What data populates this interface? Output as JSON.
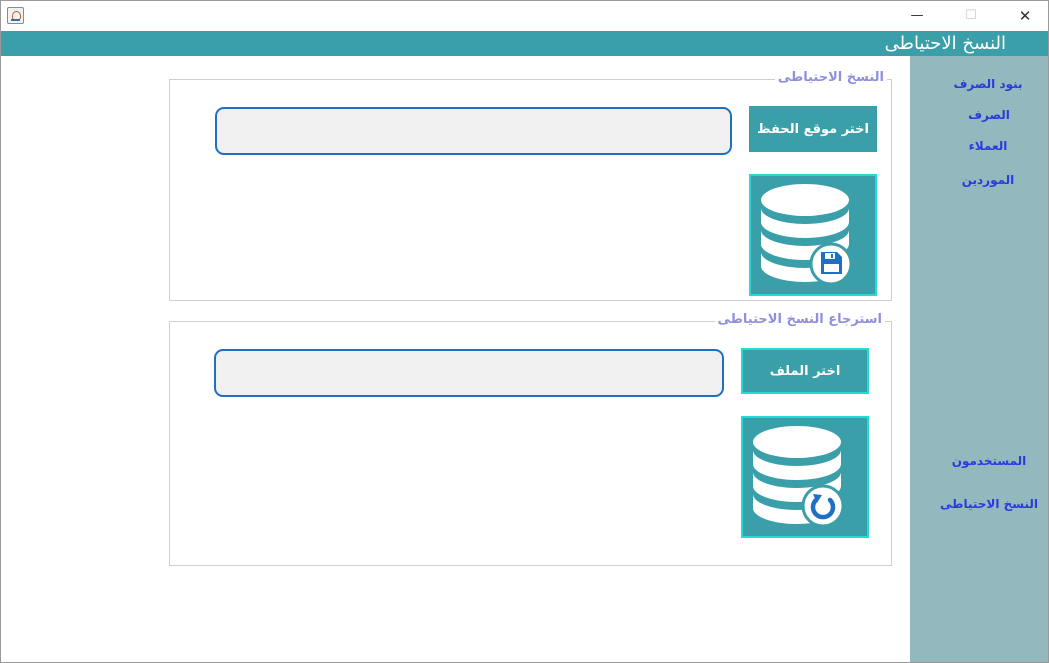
{
  "window": {
    "title_controls": {
      "minimize": "—",
      "maximize": "☐",
      "close": "✕"
    }
  },
  "header": {
    "title": "النسخ الاحتياطى"
  },
  "sidebar": {
    "items": [
      {
        "label": "بنود الصرف"
      },
      {
        "label": "الصرف"
      },
      {
        "label": "العملاء"
      },
      {
        "label": "الموردين"
      },
      {
        "label": "المستخدمون"
      },
      {
        "label": "النسخ الاحتياطى"
      }
    ]
  },
  "backup": {
    "title": "النسخ الاحتياطى",
    "choose_button": "اختر موقع الحفظ",
    "path_value": "",
    "action_icon": "database-save-icon"
  },
  "restore": {
    "title": "استرجاع النسخ الاحتياطى",
    "choose_button": "اختر الملف",
    "path_value": "",
    "action_icon": "database-restore-icon"
  },
  "colors": {
    "header": "#3a9fa8",
    "sidebar": "#93b8be",
    "sidebar_text": "#2a3bdc",
    "group_title": "#8f8fdd",
    "input_border": "#1f6fc4",
    "button_outline": "#25d9d4",
    "icon_badge": "#1f6fc4"
  }
}
